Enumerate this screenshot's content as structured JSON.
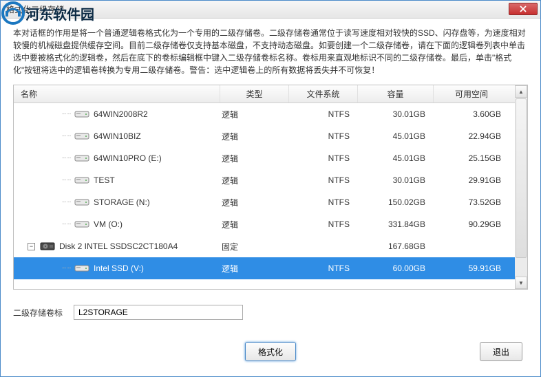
{
  "window": {
    "title": "格式化二级存储"
  },
  "watermark": {
    "text": "河东软件园"
  },
  "description": "本对话框的作用是将一个普通逻辑卷格式化为一个专用的二级存储卷。二级存储卷通常位于读写速度相对较快的SSD、闪存盘等，为速度相对较慢的机械磁盘提供缓存空间。目前二级存储卷仅支持基本磁盘，不支持动态磁盘。如要创建一个二级存储卷，请在下面的逻辑卷列表中单击选中要被格式化的逻辑卷，然后在底下的卷标编辑框中键入二级存储卷标名称。卷标用来直观地标识不同的二级存储卷。最后，单击\"格式化\"按钮将选中的逻辑卷转换为专用二级存储卷。警告：选中逻辑卷上的所有数据将丢失并不可恢复！",
  "columns": {
    "name": "名称",
    "type": "类型",
    "fs": "文件系统",
    "size": "容量",
    "free": "可用空间"
  },
  "rows": [
    {
      "indent": "vol",
      "name": "64WIN2008R2",
      "type": "逻辑",
      "fs": "NTFS",
      "size": "30.01GB",
      "free": "3.60GB",
      "selected": false
    },
    {
      "indent": "vol",
      "name": "64WIN10BIZ",
      "type": "逻辑",
      "fs": "NTFS",
      "size": "45.01GB",
      "free": "22.94GB",
      "selected": false
    },
    {
      "indent": "vol",
      "name": "64WIN10PRO (E:)",
      "type": "逻辑",
      "fs": "NTFS",
      "size": "45.01GB",
      "free": "25.15GB",
      "selected": false
    },
    {
      "indent": "vol",
      "name": "TEST",
      "type": "逻辑",
      "fs": "NTFS",
      "size": "30.01GB",
      "free": "29.91GB",
      "selected": false
    },
    {
      "indent": "vol",
      "name": "STORAGE (N:)",
      "type": "逻辑",
      "fs": "NTFS",
      "size": "150.02GB",
      "free": "73.52GB",
      "selected": false
    },
    {
      "indent": "vol",
      "name": "VM (O:)",
      "type": "逻辑",
      "fs": "NTFS",
      "size": "331.84GB",
      "free": "90.29GB",
      "selected": false
    },
    {
      "indent": "disk",
      "name": "Disk 2 INTEL SSDSC2CT180A4",
      "type": "固定",
      "fs": "",
      "size": "167.68GB",
      "free": "",
      "selected": false
    },
    {
      "indent": "vol",
      "name": "Intel SSD (V:)",
      "type": "逻辑",
      "fs": "NTFS",
      "size": "60.00GB",
      "free": "59.91GB",
      "selected": true
    }
  ],
  "labelRow": {
    "label": "二级存储卷标",
    "value": "L2STORAGE"
  },
  "buttons": {
    "format": "格式化",
    "exit": "退出"
  },
  "colors": {
    "selection": "#2f8de5",
    "border": "#4a8ac9"
  }
}
